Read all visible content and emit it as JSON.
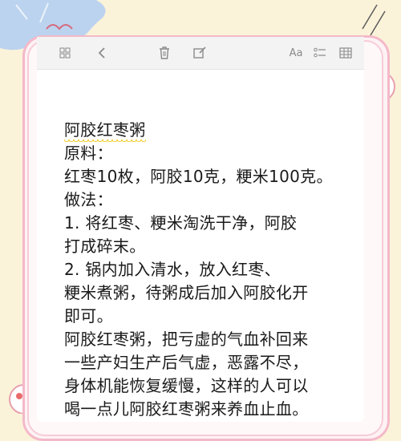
{
  "toolbar": {
    "icons": [
      "grid-icon",
      "back-icon",
      "trash-icon",
      "edit-icon",
      "font-icon",
      "checklist-icon",
      "table-icon"
    ],
    "font_label": "Aa"
  },
  "note": {
    "lines": [
      "阿胶红枣粥",
      "原料：",
      "红枣10枚，阿胶10克，粳米100克。",
      "做法：",
      "1. 将红枣、粳米淘洗干净，阿胶",
      "打成碎末。",
      "2. 锅内加入清水，放入红枣、",
      "粳米煮粥，待粥成后加入阿胶化开",
      "即可。",
      "阿胶红枣粥，把亏虚的气血补回来",
      "一些产妇生产后气虚，恶露不尽，",
      "身体机能恢复缓慢，这样的人可以",
      "喝一点儿阿胶红枣粥来养血止血。"
    ]
  },
  "colors": {
    "background": "#fbf3d9",
    "frame": "#f4b9c9",
    "highlight": "#f2cc28",
    "cloud": "#bcd3ef"
  }
}
